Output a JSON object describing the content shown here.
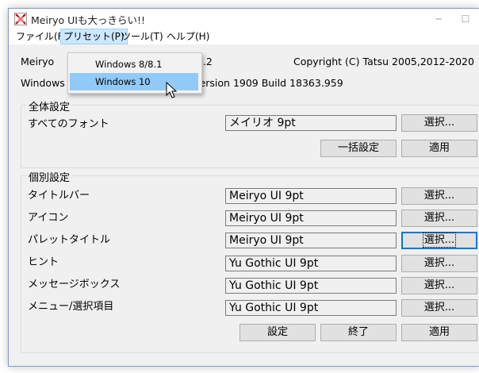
{
  "window": {
    "title": "Meiryo UIも大っきらい!!"
  },
  "menu": [
    {
      "label": "ファイル(F)"
    },
    {
      "label": "プリセット(P)"
    },
    {
      "label": "ツール(T)"
    },
    {
      "label": "ヘルプ(H)"
    }
  ],
  "info": {
    "app_name_prefix": "Meiryo",
    "version_tail": "0.2",
    "copyright": "Copyright (C) Tatsu 2005,2012-2020",
    "os_prefix": "Windows",
    "os_tail": "Version 1909  Build 18363.959"
  },
  "preset_menu": [
    {
      "label": "Windows 8/8.1"
    },
    {
      "label": "Windows 10"
    }
  ],
  "all_settings": {
    "group_label": "全体設定",
    "all_fonts_label": "すべてのフォント",
    "all_fonts_value": "メイリオ   9pt",
    "select_button": "選択...",
    "bulk_button": "一括設定",
    "apply_button": "適用"
  },
  "individual": {
    "group_label": "個別設定",
    "rows": [
      {
        "label": "タイトルバー",
        "value": "Meiryo UI   9pt",
        "button": "選択..."
      },
      {
        "label": "アイコン",
        "value": "Meiryo UI   9pt",
        "button": "選択..."
      },
      {
        "label": "パレットタイトル",
        "value": "Meiryo UI   9pt",
        "button": "選択..."
      },
      {
        "label": "ヒント",
        "value": "Yu Gothic UI   9pt",
        "button": "選択..."
      },
      {
        "label": "メッセージボックス",
        "value": "Yu Gothic UI   9pt",
        "button": "選択..."
      },
      {
        "label": "メニュー/選択項目",
        "value": "Yu Gothic UI   9pt",
        "button": "選択..."
      }
    ]
  },
  "footer": {
    "settings_button": "設定",
    "exit_button": "終了",
    "apply_button": "適用"
  },
  "titlebar_buttons": {
    "minimize": "─",
    "maximize": "☐"
  }
}
